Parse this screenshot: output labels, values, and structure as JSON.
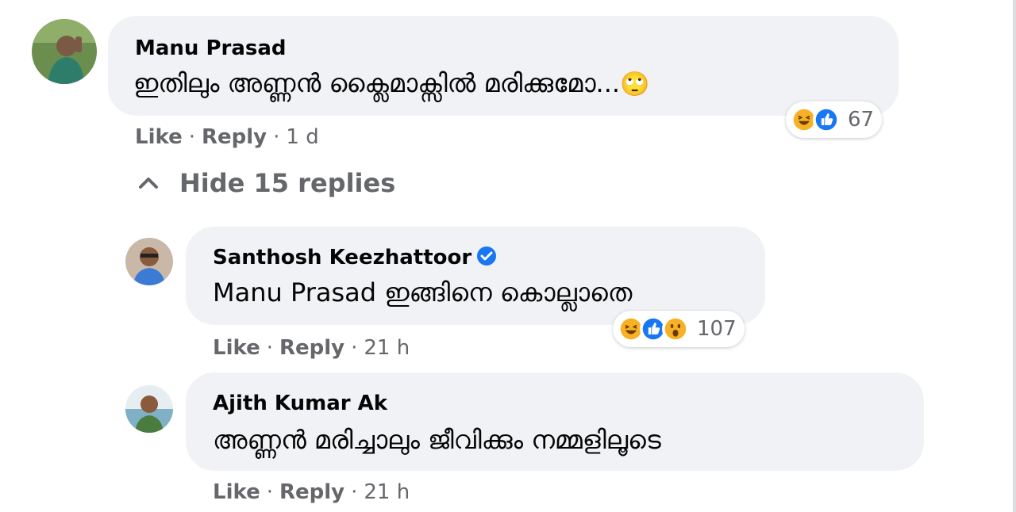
{
  "comments": [
    {
      "author": "Manu Prasad",
      "text": "ഇതിലും അണ്ണൻ ക്ലൈമാക്സിൽ മരിക്കുമോ...",
      "emoji": "🙄",
      "reactions": {
        "icons": [
          "haha-icon",
          "like-icon"
        ],
        "count": "67"
      },
      "actions": {
        "like": "Like",
        "reply": "Reply",
        "time": "1 d"
      }
    }
  ],
  "replies_toggle": {
    "label": "Hide 15 replies"
  },
  "replies": [
    {
      "author": "Santhosh Keezhattoor",
      "verified": true,
      "mention": "Manu Prasad",
      "text": " ഇങ്ങിനെ കൊല്ലാതെ",
      "reactions": {
        "icons": [
          "haha-icon",
          "like-icon",
          "wow-icon"
        ],
        "count": "107"
      },
      "actions": {
        "like": "Like",
        "reply": "Reply",
        "time": "21 h"
      }
    },
    {
      "author": "Ajith Kumar Ak",
      "verified": false,
      "text": "അണ്ണൻ മരിച്ചാലും ജീവിക്കും നമ്മളിലൂടെ",
      "actions": {
        "like": "Like",
        "reply": "Reply",
        "time": "21 h"
      }
    }
  ],
  "colors": {
    "bubble": "#f0f2f5",
    "secondary_text": "#65676b",
    "like_blue": "#1877f2",
    "haha_yellow": "#f7b125"
  }
}
